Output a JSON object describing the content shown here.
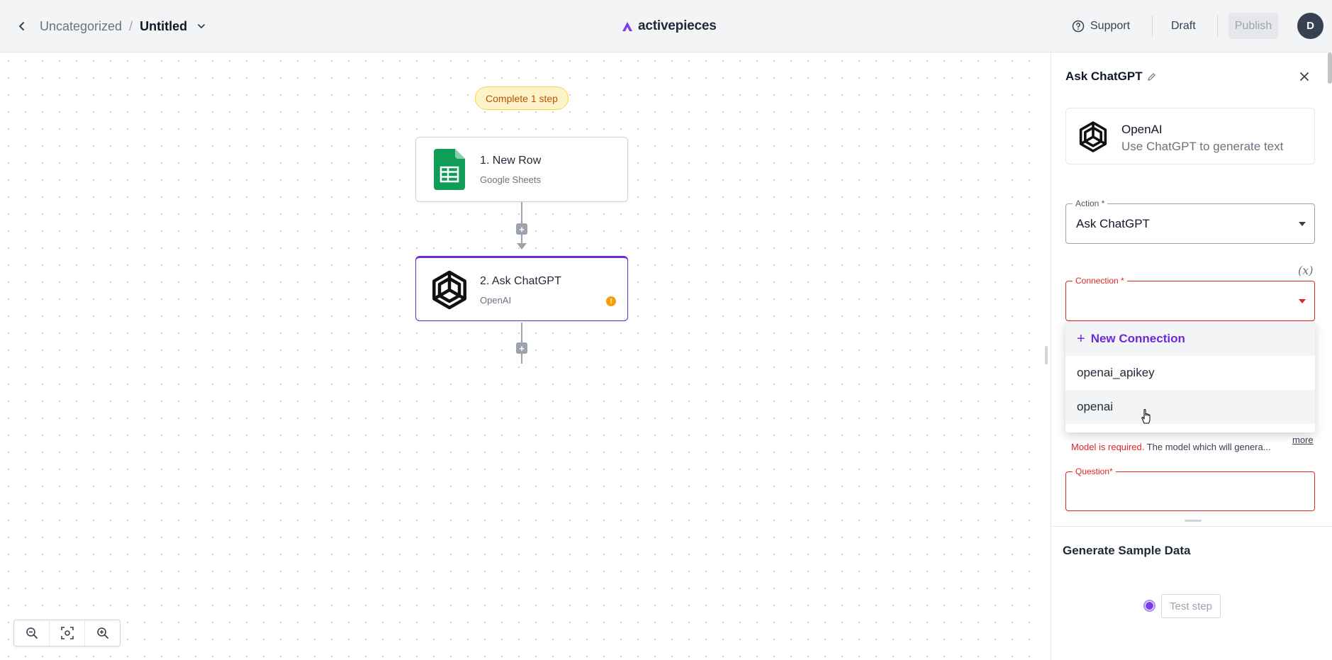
{
  "header": {
    "breadcrumb_folder": "Uncategorized",
    "breadcrumb_separator": "/",
    "flow_name": "Untitled",
    "brand_name": "activepieces",
    "support_label": "Support",
    "draft_label": "Draft",
    "publish_label": "Publish",
    "avatar_initial": "D"
  },
  "canvas": {
    "status_pill": "Complete 1 step",
    "steps": [
      {
        "title": "1. New Row",
        "subtitle": "Google Sheets",
        "icon": "google-sheets-icon"
      },
      {
        "title": "2. Ask ChatGPT",
        "subtitle": "OpenAI",
        "icon": "openai-icon",
        "warning": "!"
      }
    ],
    "add_step_symbol": "+",
    "zoom_controls": [
      "zoom-out-icon",
      "fit-view-icon",
      "zoom-in-icon"
    ]
  },
  "panel": {
    "title": "Ask ChatGPT",
    "piece_name": "OpenAI",
    "piece_description": "Use ChatGPT to generate text",
    "action_label": "Action *",
    "action_value": "Ask ChatGPT",
    "connection_label": "Connection *",
    "connection_value": "",
    "fx_label": "(x)",
    "dropdown": {
      "new_connection": "New Connection",
      "new_symbol": "+",
      "options": [
        "openai_apikey",
        "openai"
      ]
    },
    "model_error": "Model is required.",
    "model_hint": "The model which will genera...",
    "more_label": "more",
    "question_label": "Question*",
    "sample_title": "Generate Sample Data",
    "test_step_label": "Test step"
  },
  "colors": {
    "accent": "#6d28d9",
    "error": "#dc2626",
    "warning": "#f59e0b",
    "sheets_green": "#0f9d58"
  }
}
